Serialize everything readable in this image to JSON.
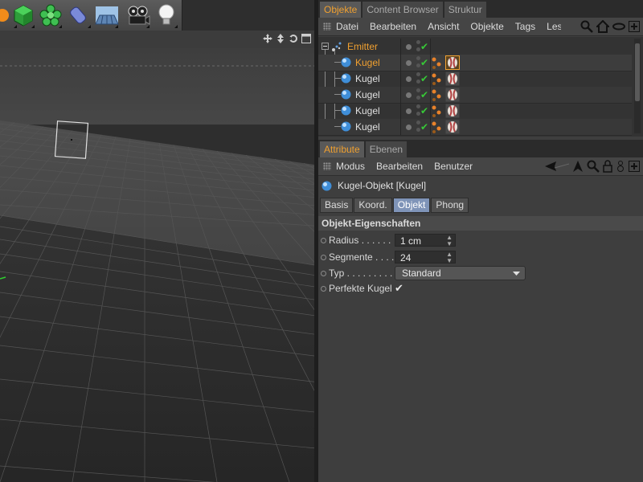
{
  "toolbar": {
    "buttons": [
      {
        "icon": "move-tool-icon"
      },
      {
        "icon": "cube-icon"
      },
      {
        "icon": "generator-icon"
      },
      {
        "icon": "deformer-icon"
      },
      {
        "icon": "scene-floor-icon"
      },
      {
        "icon": "camera-icon"
      },
      {
        "icon": "light-bulb-icon"
      }
    ]
  },
  "object_manager": {
    "tabs": [
      "Objekte",
      "Content Browser",
      "Struktur"
    ],
    "menu": [
      "Datei",
      "Bearbeiten",
      "Ansicht",
      "Objekte",
      "Tags",
      "Lese"
    ],
    "objects": [
      {
        "name": "Emitter",
        "selected": true,
        "indent": 0
      },
      {
        "name": "Kugel",
        "selected": true,
        "indent": 1
      },
      {
        "name": "Kugel",
        "selected": false,
        "indent": 1
      },
      {
        "name": "Kugel",
        "selected": false,
        "indent": 1
      },
      {
        "name": "Kugel",
        "selected": false,
        "indent": 1
      },
      {
        "name": "Kugel",
        "selected": false,
        "indent": 1
      }
    ]
  },
  "attribute_manager": {
    "tabs": [
      "Attribute",
      "Ebenen"
    ],
    "menu": [
      "Modus",
      "Bearbeiten",
      "Benutzer"
    ],
    "object_title": "Kugel-Objekt [Kugel]",
    "sub_tabs": [
      "Basis",
      "Koord.",
      "Objekt",
      "Phong"
    ],
    "active_sub_tab": "Objekt",
    "section_title": "Objekt-Eigenschaften",
    "props": {
      "radius_label": "Radius . . . . . .",
      "radius_value": "1 cm",
      "segmente_label": "Segmente . . . .",
      "segmente_value": "24",
      "typ_label": "Typ . . . . . . . . .",
      "typ_value": "Standard",
      "perfekte_label": "Perfekte Kugel",
      "perfekte_checked": "✔"
    }
  },
  "colors": {
    "accent": "#f0a030",
    "active_sub_tab": "#7f94b8",
    "check_green": "#37c837"
  }
}
